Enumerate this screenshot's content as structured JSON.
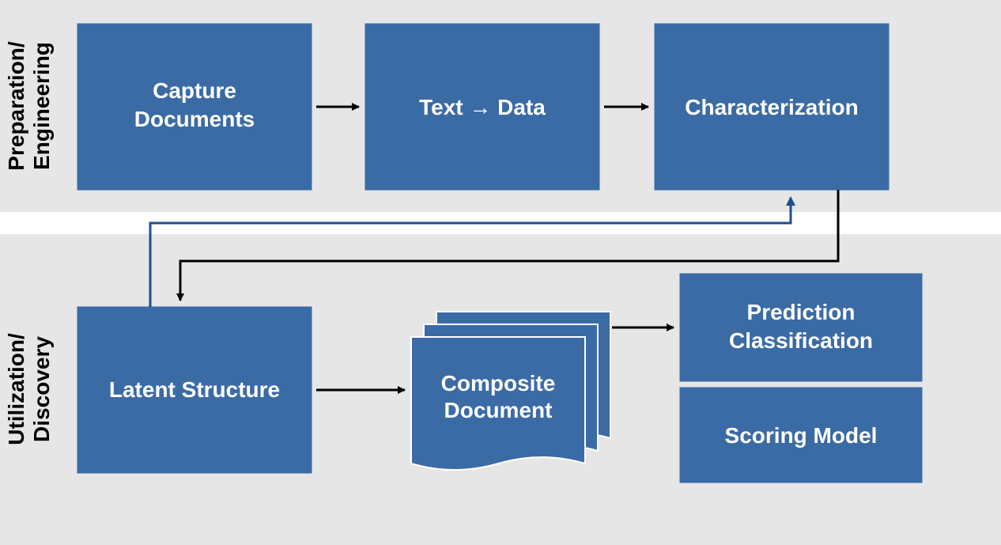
{
  "diagram": {
    "sections": {
      "top": {
        "label1": "Preparation/",
        "label2": "Engineering"
      },
      "bottom": {
        "label1": "Utilization/",
        "label2": "Discovery"
      }
    },
    "nodes": {
      "capture": {
        "line1": "Capture",
        "line2": "Documents"
      },
      "text_to_data": {
        "label": "Text → Data"
      },
      "characterization": {
        "label": "Characterization"
      },
      "latent": {
        "label": "Latent Structure"
      },
      "composite": {
        "line1": "Composite",
        "line2": "Document"
      },
      "prediction": {
        "line1": "Prediction",
        "line2": "Classification"
      },
      "scoring": {
        "label": "Scoring Model"
      }
    }
  }
}
